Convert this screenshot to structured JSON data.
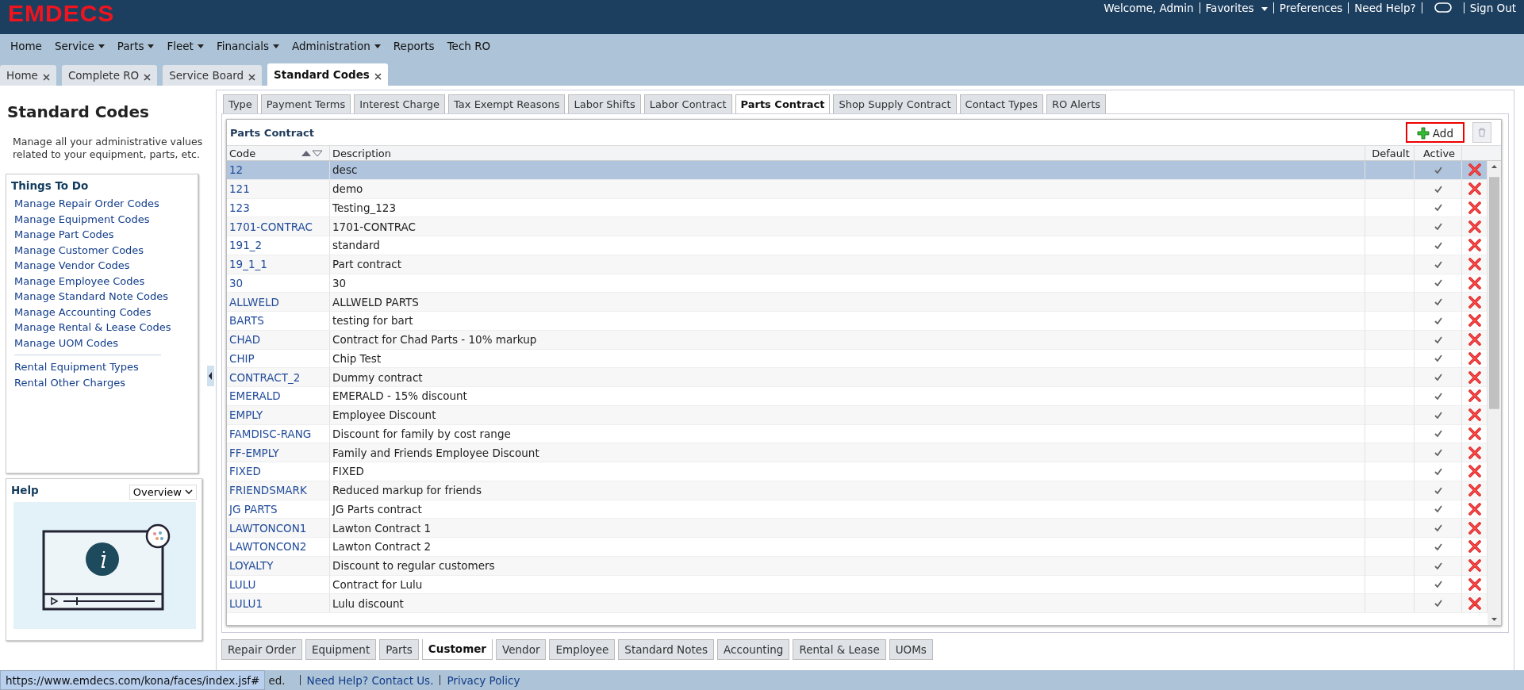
{
  "header": {
    "logo": "EMDECS",
    "welcome": "Welcome, Admin",
    "favorites": "Favorites",
    "preferences": "Preferences",
    "need_help": "Need Help?",
    "sign_out": "Sign Out"
  },
  "nav": [
    {
      "label": "Home",
      "dropdown": false
    },
    {
      "label": "Service",
      "dropdown": true
    },
    {
      "label": "Parts",
      "dropdown": true
    },
    {
      "label": "Fleet",
      "dropdown": true
    },
    {
      "label": "Financials",
      "dropdown": true
    },
    {
      "label": "Administration",
      "dropdown": true
    },
    {
      "label": "Reports",
      "dropdown": false
    },
    {
      "label": "Tech RO",
      "dropdown": false
    }
  ],
  "tabs": [
    {
      "label": "Home",
      "selected": false
    },
    {
      "label": "Complete RO",
      "selected": false
    },
    {
      "label": "Service Board",
      "selected": false
    },
    {
      "label": "Standard Codes",
      "selected": true
    }
  ],
  "sidebar": {
    "title": "Standard Codes",
    "description": "Manage all your administrative values related to your equipment, parts, etc.",
    "things_to_do": {
      "title": "Things To Do",
      "links": [
        "Manage Repair Order Codes",
        "Manage Equipment Codes",
        "Manage Part Codes",
        "Manage Customer Codes",
        "Manage Vendor Codes",
        "Manage Employee Codes",
        "Manage Standard Note Codes",
        "Manage Accounting Codes",
        "Manage Rental & Lease Codes",
        "Manage UOM Codes"
      ],
      "extra_links": [
        "Rental Equipment Types",
        "Rental Other Charges"
      ]
    },
    "help": {
      "title": "Help",
      "dropdown": "Overview"
    }
  },
  "top_tabs": [
    {
      "label": "Type",
      "selected": false
    },
    {
      "label": "Payment Terms",
      "selected": false
    },
    {
      "label": "Interest Charge",
      "selected": false
    },
    {
      "label": "Tax Exempt Reasons",
      "selected": false
    },
    {
      "label": "Labor Shifts",
      "selected": false
    },
    {
      "label": "Labor Contract",
      "selected": false
    },
    {
      "label": "Parts Contract",
      "selected": true
    },
    {
      "label": "Shop Supply Contract",
      "selected": false
    },
    {
      "label": "Contact Types",
      "selected": false
    },
    {
      "label": "RO Alerts",
      "selected": false
    }
  ],
  "panel": {
    "title": "Parts Contract",
    "add": "Add",
    "columns": [
      "Code",
      "Description",
      "Default",
      "Active"
    ],
    "rows": [
      {
        "code": "12",
        "description": "desc",
        "active": true,
        "selected": true
      },
      {
        "code": "121",
        "description": "demo",
        "active": true,
        "selected": false
      },
      {
        "code": "123",
        "description": "Testing_123",
        "active": true,
        "selected": false
      },
      {
        "code": "1701-CONTRAC",
        "description": "1701-CONTRAC",
        "active": true,
        "selected": false
      },
      {
        "code": "191_2",
        "description": "standard",
        "active": true,
        "selected": false
      },
      {
        "code": "19_1_1",
        "description": "Part contract",
        "active": true,
        "selected": false
      },
      {
        "code": "30",
        "description": "30",
        "active": true,
        "selected": false
      },
      {
        "code": "ALLWELD",
        "description": "ALLWELD PARTS",
        "active": true,
        "selected": false
      },
      {
        "code": "BARTS",
        "description": "testing for bart",
        "active": true,
        "selected": false
      },
      {
        "code": "CHAD",
        "description": "Contract for Chad Parts - 10% markup",
        "active": true,
        "selected": false
      },
      {
        "code": "CHIP",
        "description": "Chip Test",
        "active": true,
        "selected": false
      },
      {
        "code": "CONTRACT_2",
        "description": "Dummy contract",
        "active": true,
        "selected": false
      },
      {
        "code": "EMERALD",
        "description": "EMERALD - 15% discount",
        "active": true,
        "selected": false
      },
      {
        "code": "EMPLY",
        "description": "Employee Discount",
        "active": true,
        "selected": false
      },
      {
        "code": "FAMDISC-RANG",
        "description": "Discount for family by cost range",
        "active": true,
        "selected": false
      },
      {
        "code": "FF-EMPLY",
        "description": "Family and Friends Employee Discount",
        "active": true,
        "selected": false
      },
      {
        "code": "FIXED",
        "description": "FIXED",
        "active": true,
        "selected": false
      },
      {
        "code": "FRIENDSMARK",
        "description": "Reduced markup for friends",
        "active": true,
        "selected": false
      },
      {
        "code": "JG PARTS",
        "description": "JG Parts contract",
        "active": true,
        "selected": false
      },
      {
        "code": "LAWTONCON1",
        "description": "Lawton Contract 1",
        "active": true,
        "selected": false
      },
      {
        "code": "LAWTONCON2",
        "description": "Lawton Contract 2",
        "active": true,
        "selected": false
      },
      {
        "code": "LOYALTY",
        "description": "Discount to regular customers",
        "active": true,
        "selected": false
      },
      {
        "code": "LULU",
        "description": "Contract for Lulu",
        "active": true,
        "selected": false
      },
      {
        "code": "LULU1",
        "description": "Lulu discount",
        "active": true,
        "selected": false
      }
    ]
  },
  "bottom_tabs": [
    {
      "label": "Repair Order",
      "selected": false
    },
    {
      "label": "Equipment",
      "selected": false
    },
    {
      "label": "Parts",
      "selected": false
    },
    {
      "label": "Customer",
      "selected": true
    },
    {
      "label": "Vendor",
      "selected": false
    },
    {
      "label": "Employee",
      "selected": false
    },
    {
      "label": "Standard Notes",
      "selected": false
    },
    {
      "label": "Accounting",
      "selected": false
    },
    {
      "label": "Rental & Lease",
      "selected": false
    },
    {
      "label": "UOMs",
      "selected": false
    }
  ],
  "footer": {
    "status_url": "https://www.emdecs.com/kona/faces/index.jsf#",
    "text": "ed.",
    "links": [
      "Need Help? Contact Us.",
      "Privacy Policy"
    ]
  }
}
